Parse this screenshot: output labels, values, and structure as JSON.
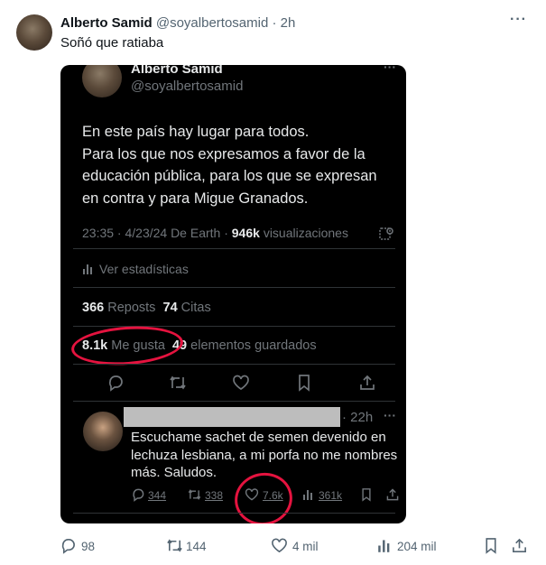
{
  "outer_post": {
    "author_name": "Alberto Samid",
    "handle": "@soyalbertosamid",
    "separator": "·",
    "time": "2h",
    "text": "Soñó que ratiaba",
    "more_glyph": "···",
    "actions": {
      "reply_count": "98",
      "repost_count": "144",
      "like_count": "4 mil",
      "view_count": "204 mil"
    }
  },
  "quoted_screenshot": {
    "author_name": "Alberto Samid",
    "handle": "@soyalbertosamid",
    "more_glyph": "···",
    "text_lines": [
      "En este país hay lugar para todos.",
      "Para los que nos expresamos a favor de la",
      "educación pública, para los que se expresan",
      "en contra y para Migue Granados."
    ],
    "meta": {
      "timestamp": "23:35 · 4/23/24 De Earth ·",
      "views_value": "946k",
      "views_label": "visualizaciones"
    },
    "stats_link": "Ver estadísticas",
    "reposts_value": "366",
    "reposts_label": "Reposts",
    "quotes_value": "74",
    "quotes_label": "Citas",
    "likes_value": "8.1k",
    "likes_label": "Me gusta",
    "bookmarks_value": "49",
    "bookmarks_label": "elementos guardados",
    "reply": {
      "time": "· 22h",
      "more_glyph": "···",
      "text_lines": [
        "Escuchame sachet de semen devenido en",
        "lechuza lesbiana, a mi porfa no me nombres",
        "más. Saludos."
      ],
      "reply_count": "344",
      "repost_count": "338",
      "like_count": "7.6k",
      "view_count": "361k"
    }
  },
  "colors": {
    "annotation_red": "#e5133f",
    "dark_bg": "#000000",
    "light_text": "#e7e9ea",
    "muted_dark": "#71767b",
    "muted_light": "#536471"
  }
}
